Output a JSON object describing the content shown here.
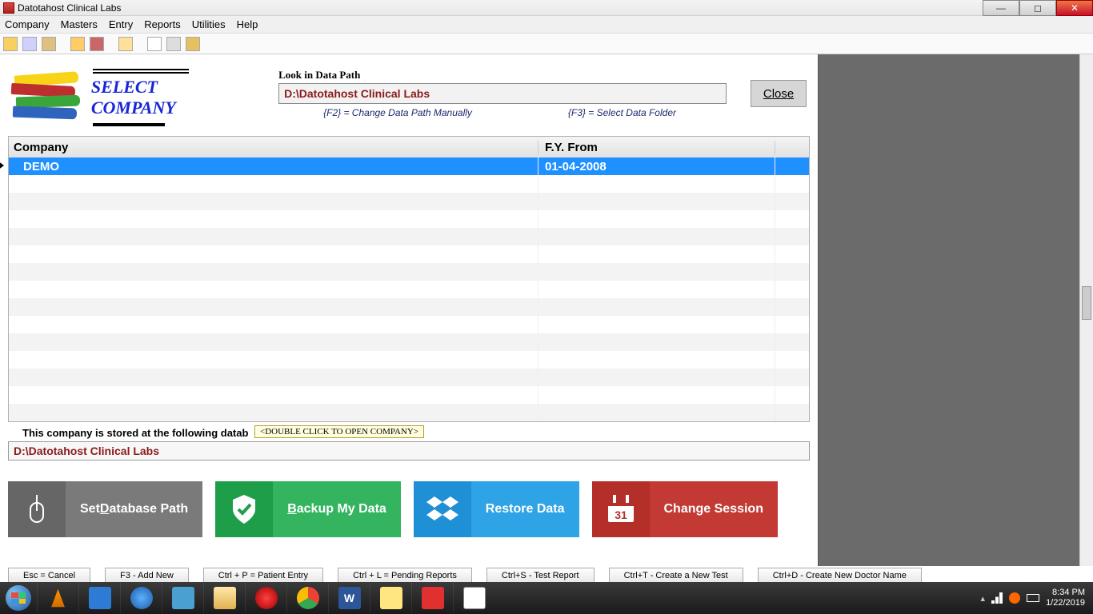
{
  "window": {
    "title": "Datotahost Clinical Labs"
  },
  "menu": {
    "items": [
      "Company",
      "Masters",
      "Entry",
      "Reports",
      "Utilities",
      "Help"
    ]
  },
  "header": {
    "title": "SELECT COMPANY",
    "path_label": "Look in Data Path",
    "path_value": "D:\\Datotahost Clinical Labs",
    "hint_f2": "{F2} = Change Data Path Manually",
    "hint_f3": "{F3} = Select Data Folder",
    "close": "Close"
  },
  "table": {
    "col1": "Company",
    "col2": "F.Y.  From",
    "rows": [
      {
        "company": "DEMO",
        "fy": "01-04-2008",
        "selected": true
      }
    ]
  },
  "stored": {
    "label": "This company is stored at the following datab",
    "hint": "<DOUBLE CLICK TO OPEN COMPANY>",
    "path": "D:\\Datotahost Clinical Labs"
  },
  "buttons": {
    "set_db": "Set Database Path",
    "backup": "Backup My Data",
    "restore": "Restore Data",
    "change_session": "Change Session"
  },
  "status": {
    "items": [
      "Esc = Cancel",
      "F3 - Add New",
      "Ctrl + P = Patient Entry",
      "Ctrl + L = Pending Reports",
      "Ctrl+S - Test Report",
      "Ctrl+T -  Create a New Test",
      "Ctrl+D - Create New Doctor Name"
    ]
  },
  "tray": {
    "time": "8:34 PM",
    "date": "1/22/2019"
  }
}
